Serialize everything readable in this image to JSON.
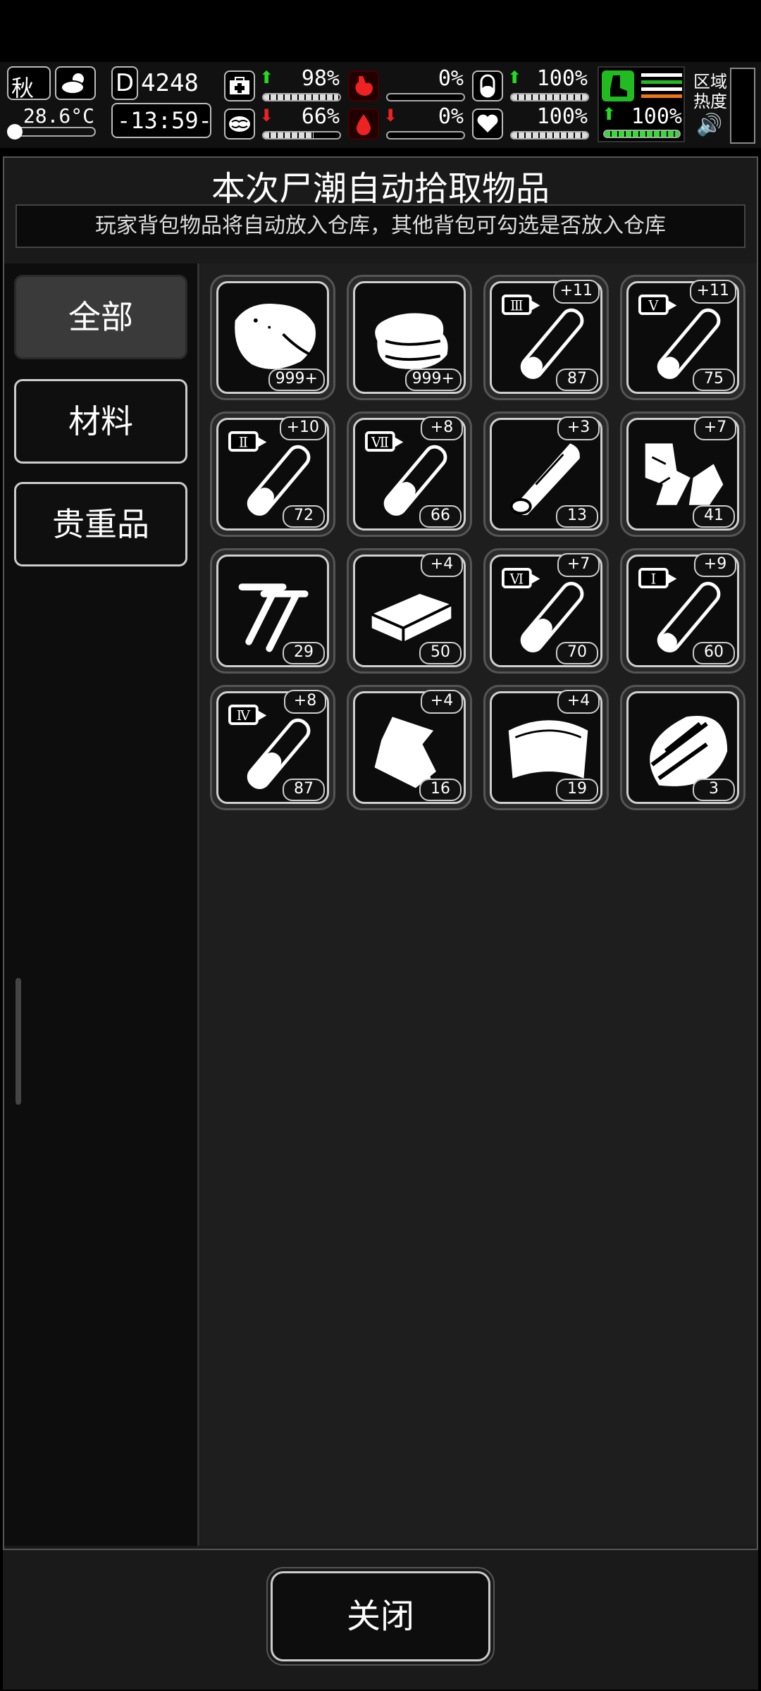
{
  "status": {
    "season": "秋",
    "temperature": "28.6°C",
    "day": "4248",
    "time": "-13:59-",
    "region_heat": "区域\n热度",
    "stats": {
      "health": "98%",
      "hunger": "0%",
      "thirst": "100%",
      "mind": "66%",
      "blood": "0%",
      "heart": "100%",
      "stamina": "100%"
    },
    "stat_levels": {
      "health": 98,
      "hunger": 0,
      "thirst": 100,
      "mind": 66,
      "blood": 0,
      "heart": 100,
      "stamina": 100
    }
  },
  "panel": {
    "title": "本次尸潮自动拾取物品",
    "subtitle": "玩家背包物品将自动放入仓库，其他背包可勾选是否放入仓库"
  },
  "sidebar": {
    "items": [
      {
        "label": "全部",
        "active": true
      },
      {
        "label": "材料",
        "active": false
      },
      {
        "label": "贵重品",
        "active": false
      }
    ]
  },
  "items": [
    {
      "name": "meat-icon",
      "count": "999+",
      "bonus": ""
    },
    {
      "name": "cloth-icon",
      "count": "999+",
      "bonus": ""
    },
    {
      "name": "vial-icon",
      "count": "87",
      "bonus": "+11",
      "tier": "Ⅲ",
      "fill": 0.25
    },
    {
      "name": "vial-icon",
      "count": "75",
      "bonus": "+11",
      "tier": "Ⅴ",
      "fill": 0.25
    },
    {
      "name": "vial-icon",
      "count": "72",
      "bonus": "+10",
      "tier": "Ⅱ",
      "fill": 0.35
    },
    {
      "name": "vial-icon",
      "count": "66",
      "bonus": "+8",
      "tier": "Ⅶ",
      "fill": 0.45
    },
    {
      "name": "wood-log-icon",
      "count": "13",
      "bonus": "+3"
    },
    {
      "name": "scrap-pieces-icon",
      "count": "41",
      "bonus": "+7"
    },
    {
      "name": "nails-icon",
      "count": "29",
      "bonus": ""
    },
    {
      "name": "brick-icon",
      "count": "50",
      "bonus": "+4"
    },
    {
      "name": "vial-icon",
      "count": "70",
      "bonus": "+7",
      "tier": "Ⅵ",
      "fill": 0.45
    },
    {
      "name": "vial-icon",
      "count": "60",
      "bonus": "+9",
      "tier": "Ⅰ",
      "fill": 0.2
    },
    {
      "name": "vial-icon",
      "count": "87",
      "bonus": "+8",
      "tier": "Ⅳ",
      "fill": 0.5
    },
    {
      "name": "pouch-icon",
      "count": "16",
      "bonus": "+4"
    },
    {
      "name": "leather-sheet-icon",
      "count": "19",
      "bonus": "+4"
    },
    {
      "name": "wood-shards-icon",
      "count": "3",
      "bonus": ""
    }
  ],
  "footer": {
    "close_label": "关闭"
  }
}
